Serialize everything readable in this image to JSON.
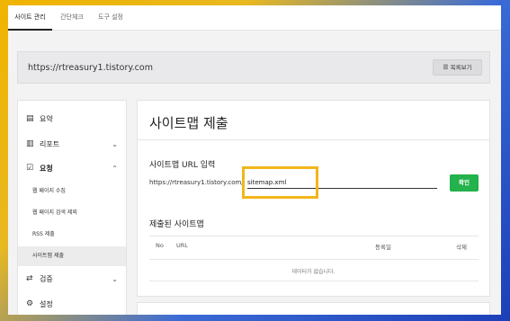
{
  "tabs": [
    {
      "label": "사이트 관리"
    },
    {
      "label": "간단체크"
    },
    {
      "label": "도구 설정"
    }
  ],
  "site": {
    "url": "https://rtreasury1.tistory.com",
    "list_button": "목록보기"
  },
  "sidebar": {
    "items": [
      {
        "label": "요약"
      },
      {
        "label": "리포트",
        "chevron": "⌄"
      },
      {
        "label": "요청",
        "chevron": "⌃"
      },
      {
        "label": "검증",
        "chevron": "⌄"
      },
      {
        "label": "설정"
      }
    ],
    "subitems": [
      {
        "label": "웹 페이지 수집"
      },
      {
        "label": "웹 페이지 검색 제외"
      },
      {
        "label": "RSS 제출"
      },
      {
        "label": "사이트맵 제출"
      }
    ]
  },
  "main": {
    "title": "사이트맵 제출",
    "url_section_title": "사이트맵 URL 입력",
    "url_prefix": "https://rtreasury1.tistory.com/",
    "input_value": "sitemap.xml",
    "confirm_label": "확인",
    "submitted_title": "제출된 사이트맵",
    "columns": {
      "no": "No",
      "url": "URL",
      "date": "등록일",
      "delete": "삭제"
    },
    "empty_text": "데이터가 없습니다."
  },
  "colors": {
    "confirm": "#23b24b",
    "highlight": "#f2b61a"
  }
}
